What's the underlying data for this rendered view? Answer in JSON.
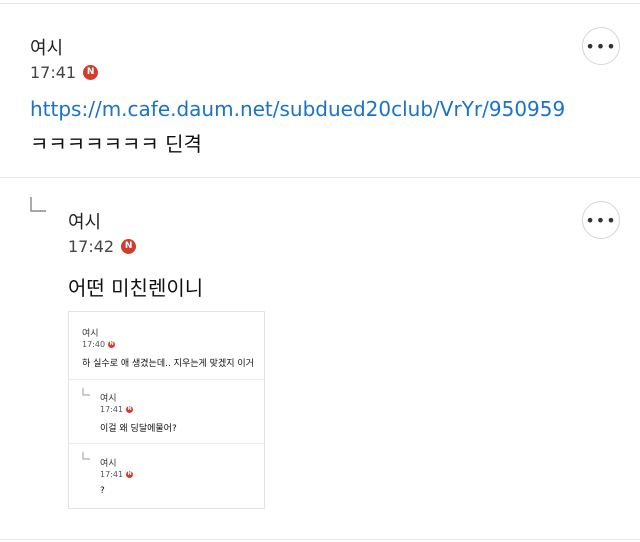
{
  "comments": [
    {
      "author": "여시",
      "time": "17:41",
      "badge": "N",
      "link": "https://m.cafe.daum.net/subdued20club/VrYr/950959",
      "text": "ㅋㅋㅋㅋㅋㅋㅋ 딘격",
      "more": "•••"
    },
    {
      "author": "여시",
      "time": "17:42",
      "badge": "N",
      "text": "어떤 미친렌이니",
      "more": "•••"
    }
  ],
  "embedded_image": {
    "comments": [
      {
        "author": "여시",
        "time": "17:40",
        "badge": "N",
        "text": "하 실수로 애 생겼는데.. 지우는게 맞겠지 이거"
      },
      {
        "author": "여시",
        "time": "17:41",
        "badge": "N",
        "text": "이걸 왜 딩달에물어?"
      },
      {
        "author": "여시",
        "time": "17:41",
        "badge": "N",
        "text": "?"
      }
    ]
  },
  "colors": {
    "link": "#1a73c8",
    "badge": "#d33b2c"
  }
}
